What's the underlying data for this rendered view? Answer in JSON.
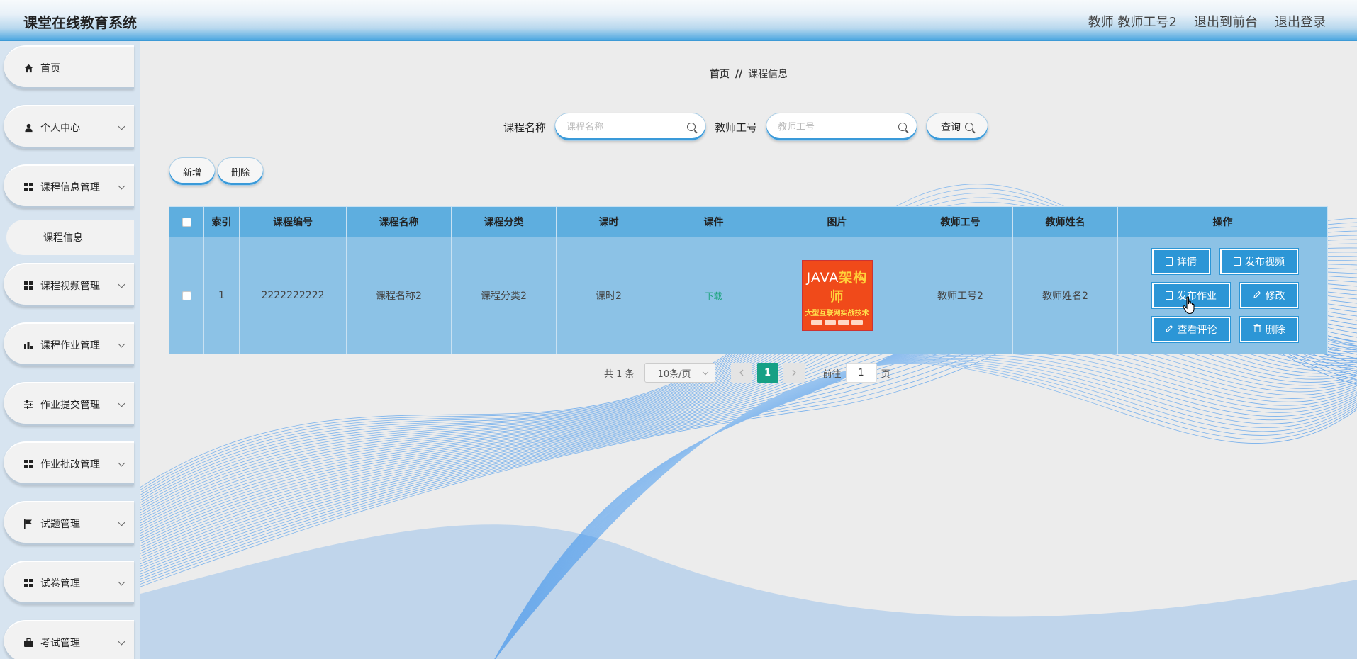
{
  "header": {
    "app_title": "课堂在线教育系统",
    "user_label": "教师 教师工号2",
    "back_to_front": "退出到前台",
    "logout": "退出登录"
  },
  "sidebar": {
    "items": [
      {
        "label": "首页",
        "icon": "home-icon"
      },
      {
        "label": "个人中心",
        "icon": "user-icon"
      },
      {
        "label": "课程信息管理",
        "icon": "grid-icon"
      },
      {
        "label": "课程视频管理",
        "icon": "grid-icon"
      },
      {
        "label": "课程作业管理",
        "icon": "bar-chart-icon"
      },
      {
        "label": "作业提交管理",
        "icon": "sliders-icon"
      },
      {
        "label": "作业批改管理",
        "icon": "grid-icon"
      },
      {
        "label": "试题管理",
        "icon": "flag-icon"
      },
      {
        "label": "试卷管理",
        "icon": "grid-icon"
      },
      {
        "label": "考试管理",
        "icon": "briefcase-icon"
      }
    ],
    "sub_item": "课程信息"
  },
  "breadcrumb": {
    "home": "首页",
    "separator": "//",
    "current": "课程信息"
  },
  "search": {
    "course_name_label": "课程名称",
    "course_name_placeholder": "课程名称",
    "teacher_id_label": "教师工号",
    "teacher_id_placeholder": "教师工号",
    "query_label": "查询"
  },
  "actions": {
    "add_label": "新增",
    "delete_label": "删除"
  },
  "table": {
    "columns": [
      "索引",
      "课程编号",
      "课程名称",
      "课程分类",
      "课时",
      "课件",
      "图片",
      "教师工号",
      "教师姓名",
      "操作"
    ],
    "rows": [
      {
        "index": "1",
        "course_no": "2222222222",
        "course_name": "课程名称2",
        "category": "课程分类2",
        "hours": "课时2",
        "courseware": "下载",
        "teacher_id": "教师工号2",
        "teacher_name": "教师姓名2",
        "ops": {
          "detail": "详情",
          "publish_video": "发布视频",
          "publish_homework": "发布作业",
          "edit": "修改",
          "view_comments": "查看评论",
          "delete": "删除"
        }
      }
    ]
  },
  "cover_image": {
    "line1_latin": "JAVA",
    "line1_cn": "架构师",
    "line2": "大型互联网实战技术"
  },
  "pagination": {
    "total": "共 1 条",
    "page_size": "10条/页",
    "current_page": "1",
    "goto_label": "前往",
    "goto_value": "1",
    "page_suffix": "页"
  },
  "colors": {
    "accent": "#2c96d6",
    "header_row": "#5eaedf",
    "body_row": "#8cc2e6",
    "pager_active": "#16a085"
  }
}
